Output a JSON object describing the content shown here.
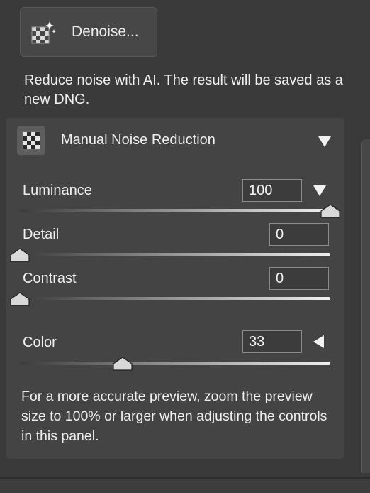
{
  "denoise": {
    "label": "Denoise...",
    "icon": "denoise-sparkle-icon"
  },
  "description": "Reduce noise with AI. The result will be saved as a new DNG.",
  "panel": {
    "title": "Manual Noise Reduction",
    "icon": "noise-checker-icon",
    "collapse_icon": "triangle-down-icon"
  },
  "sliders": {
    "luminance": {
      "label": "Luminance",
      "value": "100",
      "fraction": 1.0,
      "expand_icon": "triangle-down-icon"
    },
    "detail": {
      "label": "Detail",
      "value": "0",
      "fraction": 0.0
    },
    "contrast": {
      "label": "Contrast",
      "value": "0",
      "fraction": 0.0
    },
    "color": {
      "label": "Color",
      "value": "33",
      "fraction": 0.33,
      "expand_icon": "triangle-left-icon"
    }
  },
  "hint": "For a more accurate preview, zoom the preview size to 100% or larger when adjusting the controls in this panel.",
  "colors": {
    "background": "#3a3a3a",
    "panel": "#444444",
    "text": "#efefef"
  }
}
